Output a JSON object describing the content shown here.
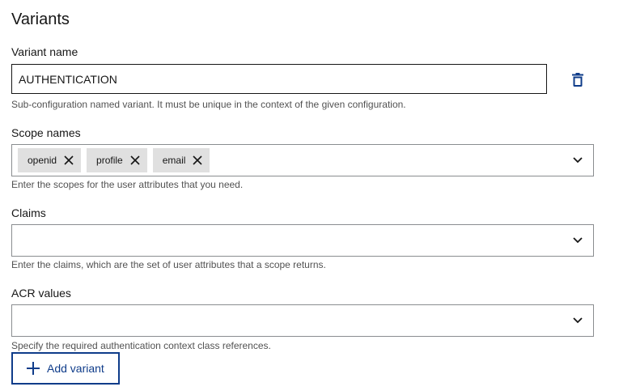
{
  "section": {
    "title": "Variants"
  },
  "variant_name": {
    "label": "Variant name",
    "value": "AUTHENTICATION",
    "helper": "Sub-configuration named variant. It must be unique in the context of the given configuration.",
    "delete_icon": "trash-icon"
  },
  "scope_names": {
    "label": "Scope names",
    "chips": [
      {
        "label": "openid"
      },
      {
        "label": "profile"
      },
      {
        "label": "email"
      }
    ],
    "helper": "Enter the scopes for the user attributes that you need."
  },
  "claims": {
    "label": "Claims",
    "helper": "Enter the claims, which are the set of user attributes that a scope returns."
  },
  "acr_values": {
    "label": "ACR values",
    "helper": "Specify the required authentication context class references."
  },
  "add_variant": {
    "label": "Add variant",
    "icon": "plus-icon"
  },
  "colors": {
    "accent": "#0f3c8a",
    "chip_bg": "#e0e0e0",
    "helper_text": "#525252"
  }
}
